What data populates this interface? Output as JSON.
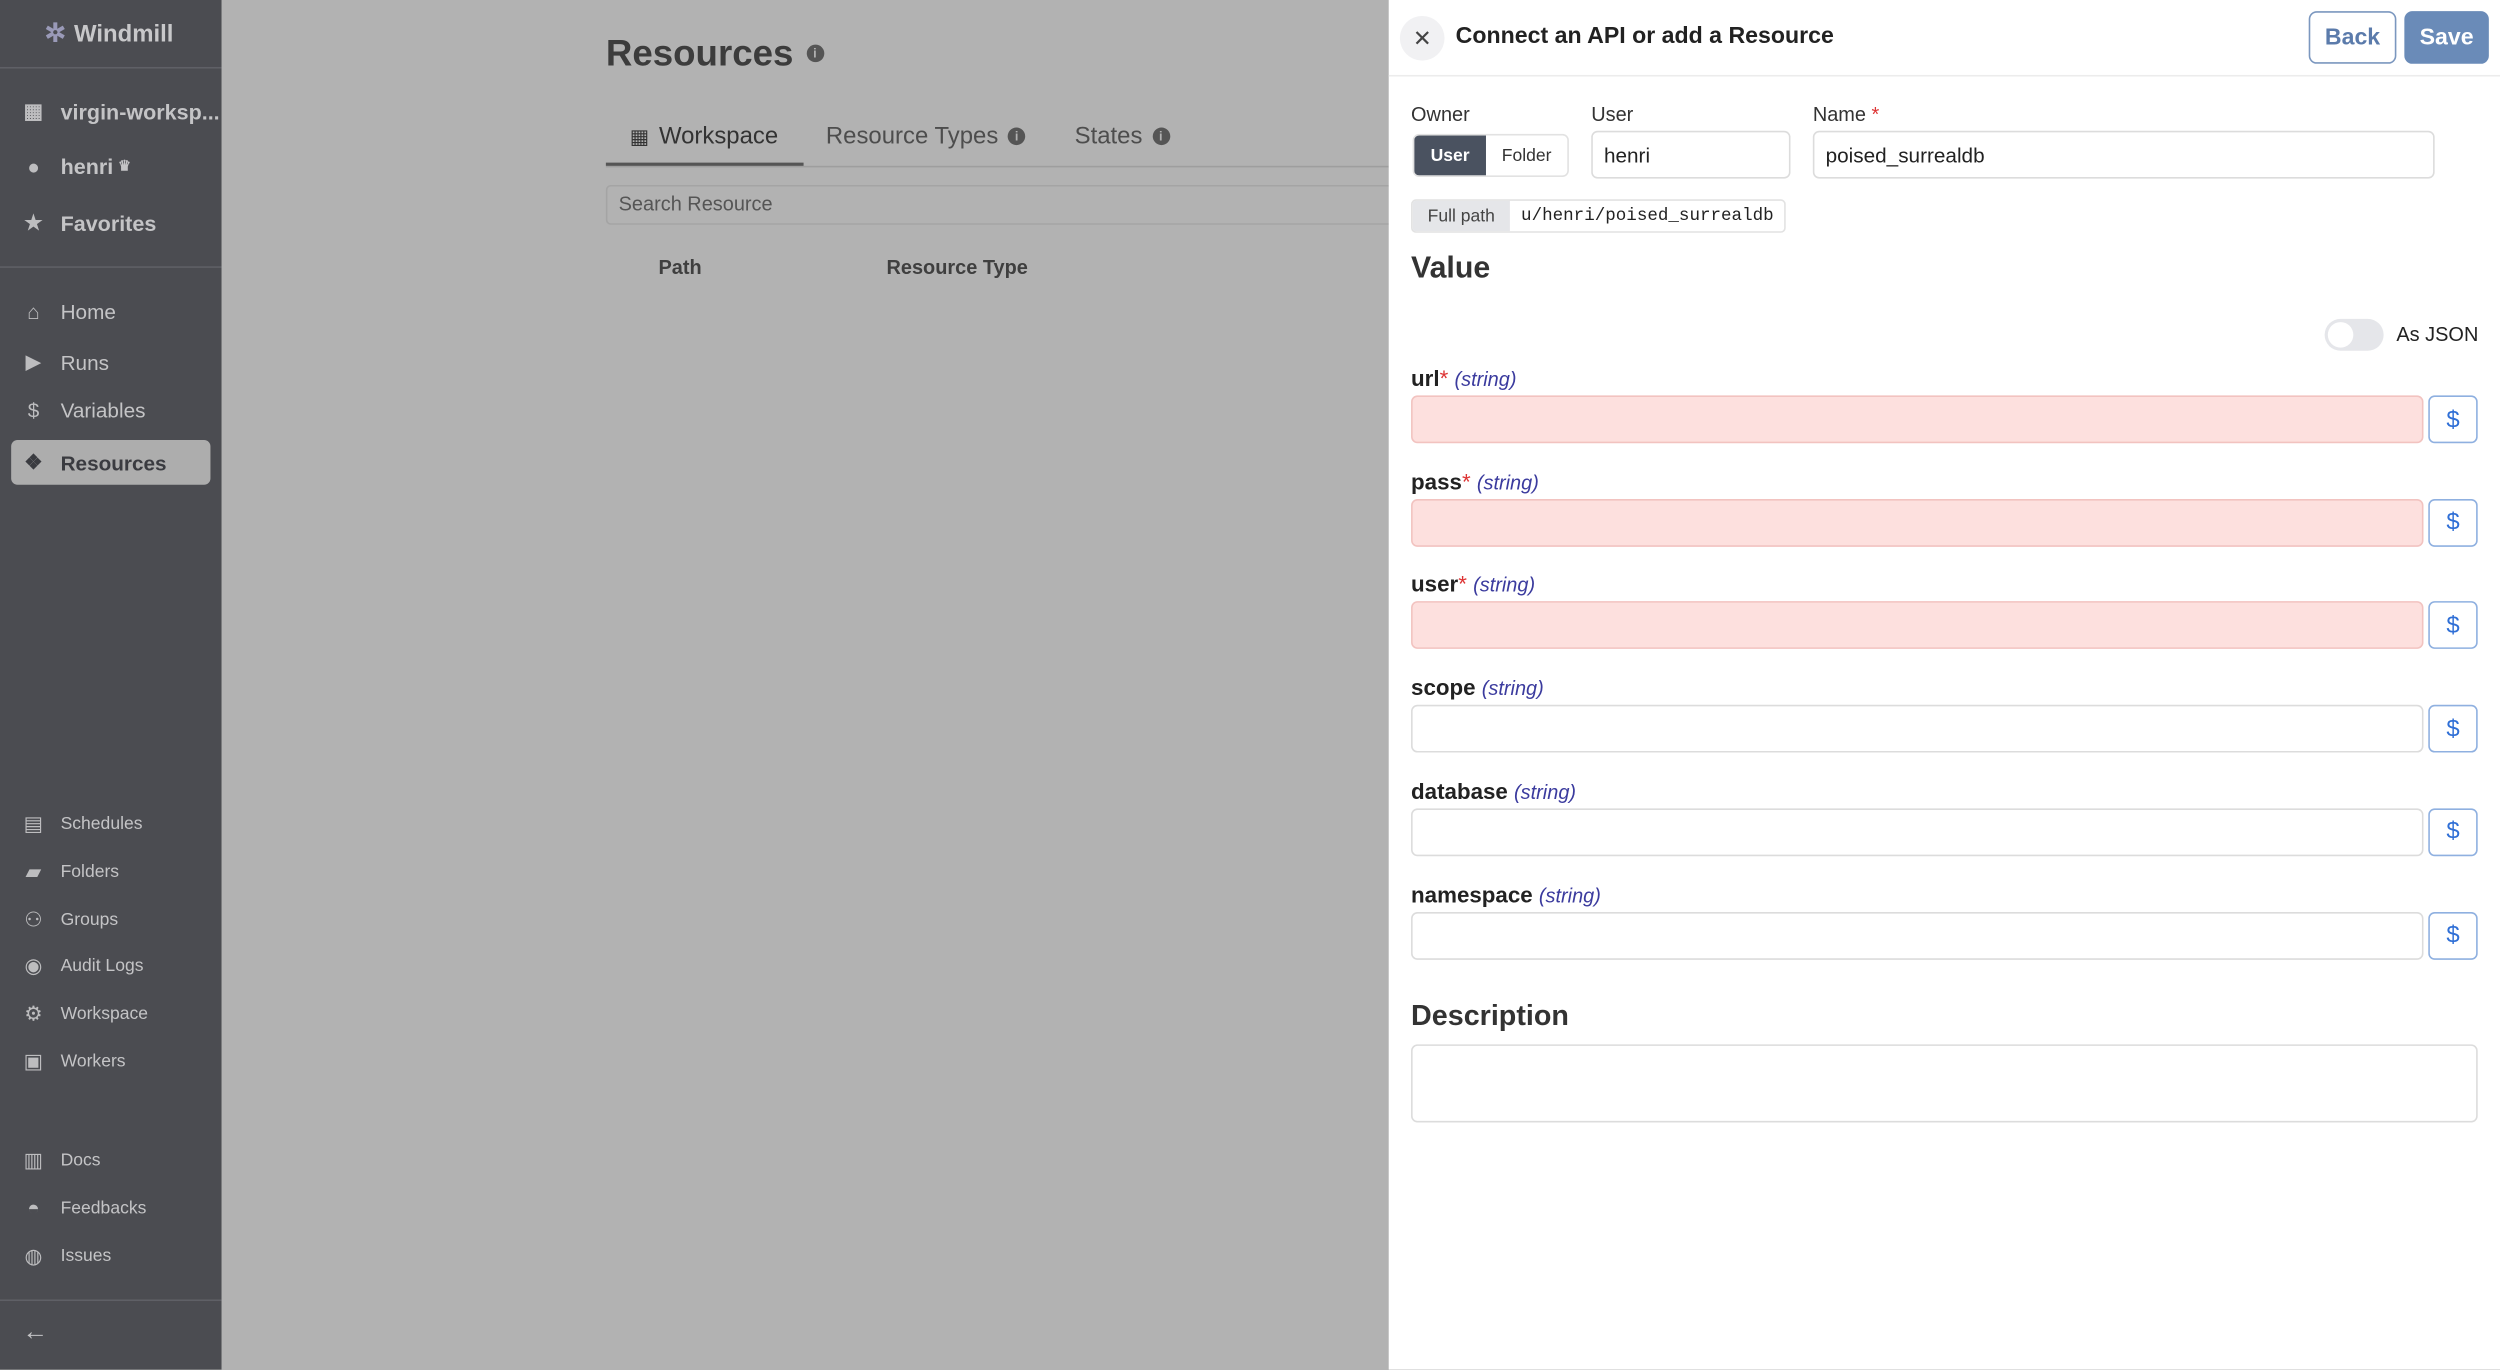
{
  "sidebar": {
    "brand": "Windmill",
    "workspace": "virgin-worksp...",
    "user": "henri",
    "favorites": "Favorites",
    "nav": [
      {
        "label": "Home",
        "icon": "home-icon"
      },
      {
        "label": "Runs",
        "icon": "play-icon"
      },
      {
        "label": "Variables",
        "icon": "dollar-icon"
      },
      {
        "label": "Resources",
        "icon": "cubes-icon",
        "active": true
      }
    ],
    "secondary": [
      {
        "label": "Schedules",
        "icon": "calendar-icon"
      },
      {
        "label": "Folders",
        "icon": "folder-icon"
      },
      {
        "label": "Groups",
        "icon": "users-gear-icon"
      },
      {
        "label": "Audit Logs",
        "icon": "eye-icon"
      },
      {
        "label": "Workspace",
        "icon": "gear-icon"
      },
      {
        "label": "Workers",
        "icon": "robot-icon"
      }
    ],
    "links": [
      {
        "label": "Docs",
        "icon": "book-icon"
      },
      {
        "label": "Feedbacks",
        "icon": "discord-icon"
      },
      {
        "label": "Issues",
        "icon": "github-icon"
      }
    ]
  },
  "main": {
    "title": "Resources",
    "tabs": [
      {
        "label": "Workspace",
        "active": true
      },
      {
        "label": "Resource Types"
      },
      {
        "label": "States"
      }
    ],
    "search_placeholder": "Search Resource",
    "columns": [
      "Path",
      "Resource Type"
    ]
  },
  "drawer": {
    "title": "Connect an API or add a Resource",
    "back": "Back",
    "save": "Save",
    "owner_label": "Owner",
    "owner_options": [
      "User",
      "Folder"
    ],
    "owner_selected": "User",
    "user_label": "User",
    "user_value": "henri",
    "name_label": "Name",
    "name_value": "poised_surrealdb",
    "full_path_label": "Full path",
    "full_path": "u/henri/poised_surrealdb",
    "value_heading": "Value",
    "as_json_label": "As JSON",
    "as_json_on": false,
    "fields": [
      {
        "name": "url",
        "required": true,
        "type": "(string)",
        "value": ""
      },
      {
        "name": "pass",
        "required": true,
        "type": "(string)",
        "value": ""
      },
      {
        "name": "user",
        "required": true,
        "type": "(string)",
        "value": ""
      },
      {
        "name": "scope",
        "required": false,
        "type": "(string)",
        "value": ""
      },
      {
        "name": "database",
        "required": false,
        "type": "(string)",
        "value": ""
      },
      {
        "name": "namespace",
        "required": false,
        "type": "(string)",
        "value": ""
      }
    ],
    "description_heading": "Description",
    "description_value": ""
  },
  "colors": {
    "accent": "#6a8bb8",
    "error_bg": "#fde0de",
    "sidebar": "#4b4c51",
    "overlay": "#b2b2b2"
  }
}
